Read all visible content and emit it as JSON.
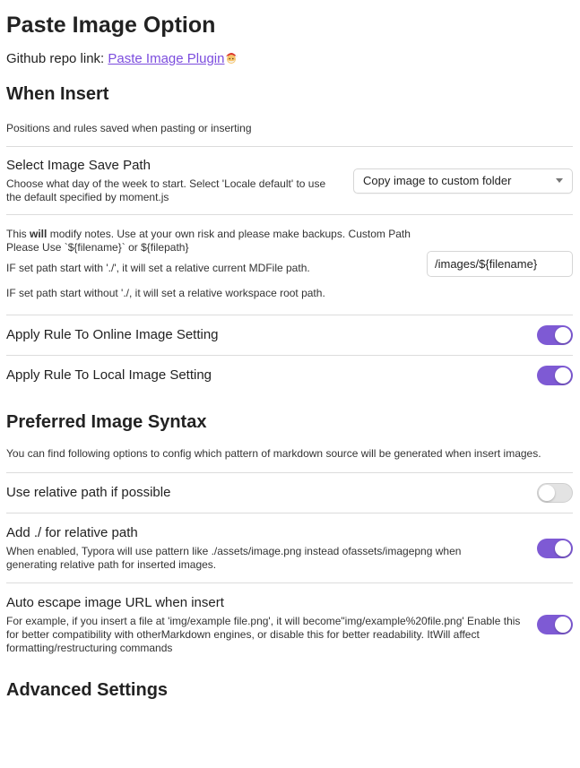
{
  "page_title": "Paste Image Option",
  "repo": {
    "prefix": "Github repo link: ",
    "link_label": "Paste Image Plugin",
    "emoji_icon": "santa-face-icon"
  },
  "when_insert": {
    "heading": "When Insert",
    "desc": "Positions and rules saved when pasting or inserting",
    "save_path": {
      "name": "Select Image Save Path",
      "desc": "Choose what day of the week to start. Select 'Locale default' to use the default specified by moment.js",
      "selected": "Copy image to custom folder"
    },
    "custom_path": {
      "desc_pre": "This ",
      "desc_bold": "will",
      "desc_post": " modify notes. Use at your own risk and please make backups. Custom Path Please Use `${filename}` or ${filepath}",
      "rule1": "IF set path start with './', it will set a relative current MDFile path.",
      "rule2": "IF set path start without './, it will set a relative workspace root path.",
      "value": "/images/${filename}"
    },
    "online_rule": {
      "name": "Apply Rule To Online Image Setting",
      "enabled": true
    },
    "local_rule": {
      "name": "Apply Rule To Local Image Setting",
      "enabled": true
    }
  },
  "preferred_syntax": {
    "heading": "Preferred Image Syntax",
    "desc": "You can find following options to config which pattern of markdown source will be generated when insert images.",
    "relative_path": {
      "name": "Use relative path if possible",
      "enabled": false
    },
    "add_dot_slash": {
      "name": "Add ./ for relative path",
      "desc": "When enabled, Typora will use pattern like ./assets/image.png instead ofassets/imagepng when generating relative path for inserted images.",
      "enabled": true
    },
    "auto_escape": {
      "name": "Auto escape image URL when insert",
      "desc": "For example, if you insert a file at 'img/example file.png', it will become\"img/example%20file.png' Enable this for better compatibility with otherMarkdown engines, or disable this for better readability. ItWill affect formatting/restructuring commands",
      "enabled": true
    }
  },
  "advanced": {
    "heading": "Advanced Settings"
  },
  "colors": {
    "accent": "#7e5ad4",
    "link": "#7c4dde",
    "divider": "#dcdcdc"
  }
}
